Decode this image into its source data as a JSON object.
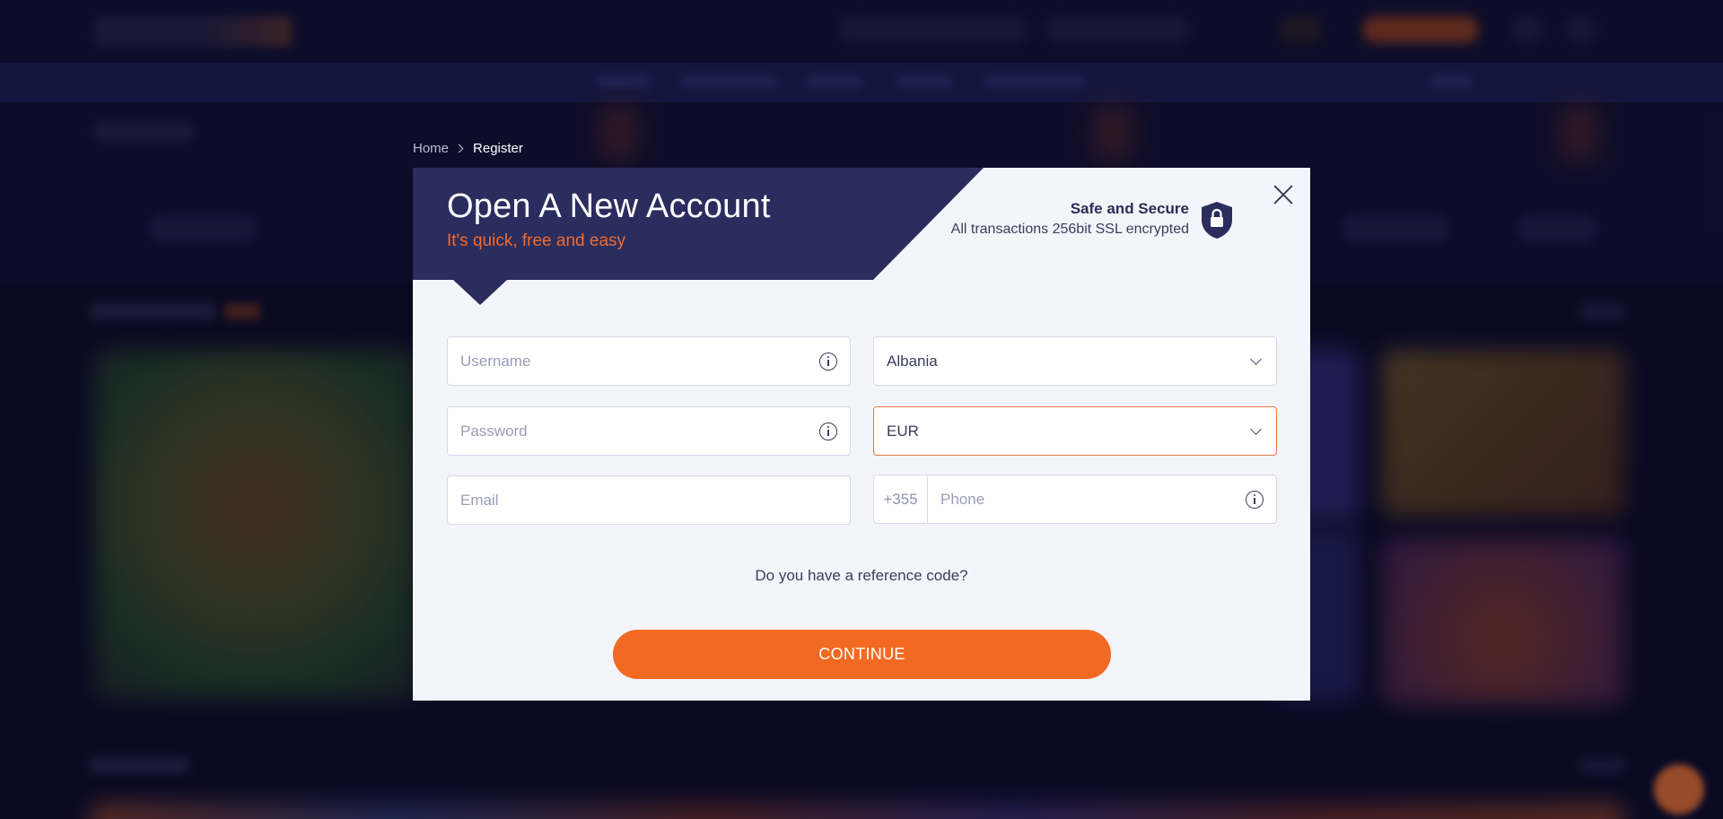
{
  "breadcrumb": {
    "home": "Home",
    "current": "Register"
  },
  "modal": {
    "title": "Open A New Account",
    "subtitle": "It's quick, free and easy",
    "secure_title": "Safe and Secure",
    "secure_text": "All transactions 256bit SSL encrypted",
    "close_icon": "close-icon",
    "shield_icon": "shield-lock-icon"
  },
  "form": {
    "username": {
      "placeholder": "Username",
      "value": ""
    },
    "password": {
      "placeholder": "Password",
      "value": ""
    },
    "email": {
      "placeholder": "Email",
      "value": ""
    },
    "country": {
      "selected": "Albania"
    },
    "currency": {
      "selected": "EUR"
    },
    "phone": {
      "prefix": "+355",
      "placeholder": "Phone",
      "value": ""
    },
    "reference_link": "Do you have a reference code?",
    "continue_label": "CONTINUE"
  },
  "colors": {
    "header_navy": "#2b2d5e",
    "accent_orange": "#f26a22",
    "modal_bg": "#f4f5fb",
    "backdrop": "#0f0f2a"
  }
}
